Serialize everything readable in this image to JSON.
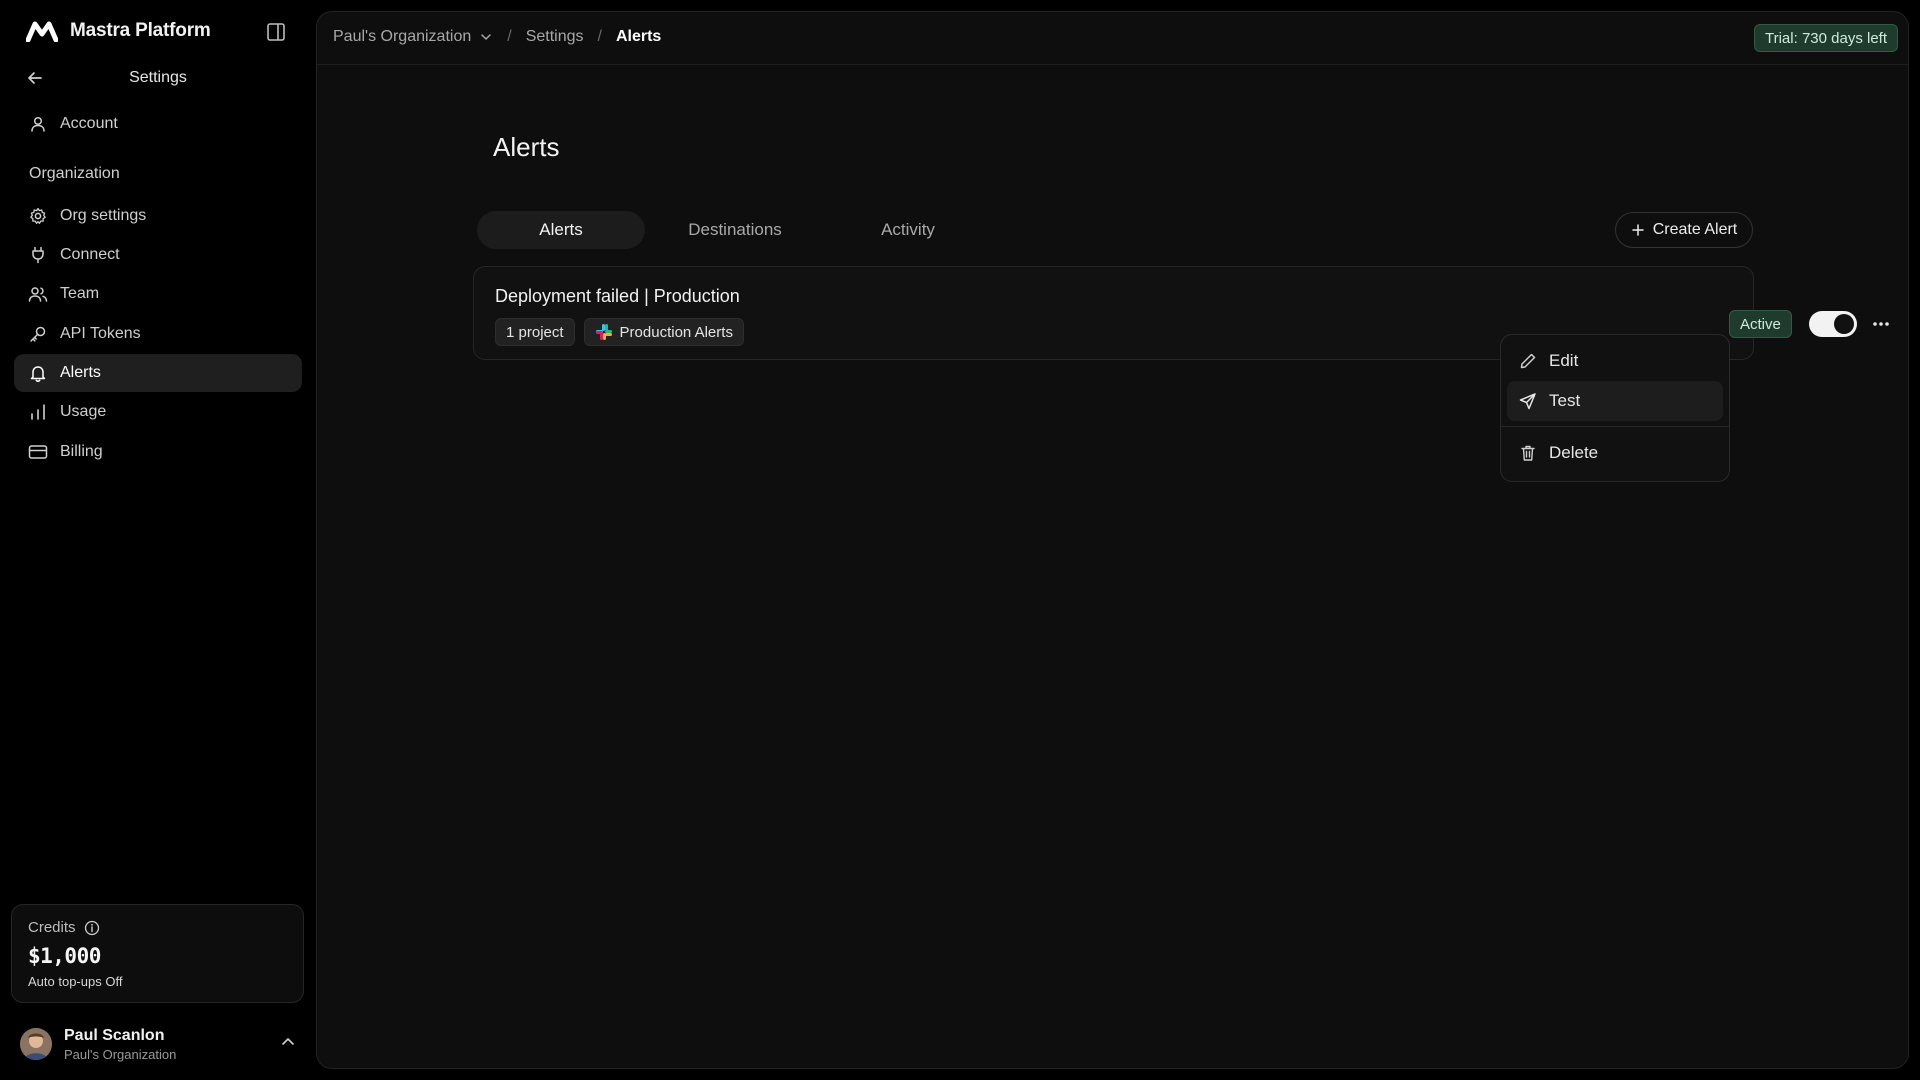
{
  "sidebar": {
    "brand": "Mastra Platform",
    "settings_title": "Settings",
    "account_label": "Account",
    "section_label": "Organization",
    "items": [
      {
        "label": "Org settings",
        "icon": "gear-icon"
      },
      {
        "label": "Connect",
        "icon": "plug-icon"
      },
      {
        "label": "Team",
        "icon": "team-icon"
      },
      {
        "label": "API Tokens",
        "icon": "key-icon"
      },
      {
        "label": "Alerts",
        "icon": "bell-icon",
        "active": true
      },
      {
        "label": "Usage",
        "icon": "bar-chart-icon"
      },
      {
        "label": "Billing",
        "icon": "credit-card-icon"
      }
    ],
    "credits": {
      "label": "Credits",
      "amount": "$1,000",
      "auto_topup": "Auto top-ups Off"
    },
    "user": {
      "name": "Paul Scanlon",
      "org": "Paul's Organization"
    }
  },
  "topbar": {
    "breadcrumb": {
      "org": "Paul's Organization",
      "section": "Settings",
      "current": "Alerts",
      "separator": "/"
    },
    "trial_badge": "Trial: 730 days left"
  },
  "main": {
    "title": "Alerts",
    "tabs": [
      {
        "label": "Alerts",
        "active": true
      },
      {
        "label": "Destinations"
      },
      {
        "label": "Activity"
      }
    ],
    "create_button": "Create Alert",
    "alert": {
      "name": "Deployment failed | Production",
      "projects_chip": "1 project",
      "destination_chip": "Production Alerts",
      "status": "Active",
      "enabled": true
    },
    "menu": {
      "edit": "Edit",
      "test": "Test",
      "delete": "Delete"
    }
  },
  "colors": {
    "background": "#000000",
    "panel": "#0e0e0e",
    "accent_green_bg": "#1e3b2e",
    "accent_green_text": "#cfead9"
  }
}
